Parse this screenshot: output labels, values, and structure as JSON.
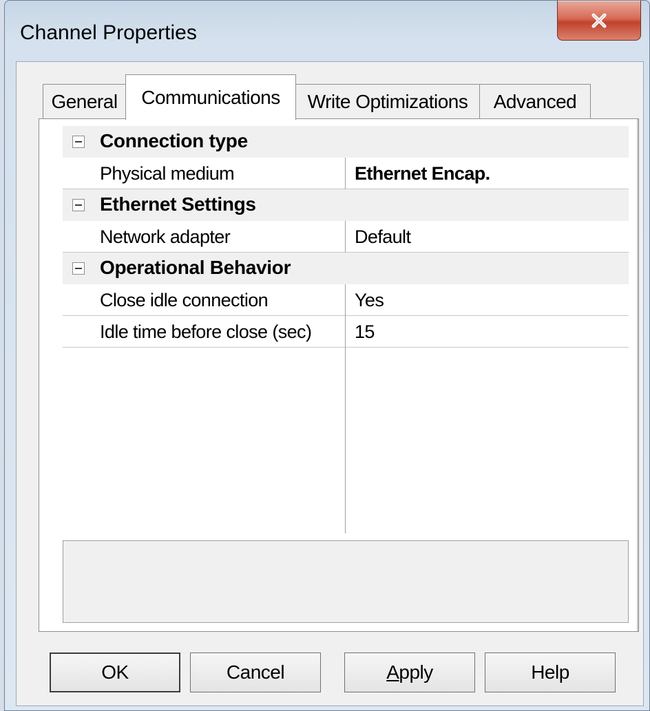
{
  "window": {
    "title": "Channel Properties",
    "close_glyph": "X"
  },
  "tabs": [
    {
      "label": "General",
      "active": false
    },
    {
      "label": "Communications",
      "active": true
    },
    {
      "label": "Write Optimizations",
      "active": false
    },
    {
      "label": "Advanced",
      "active": false
    }
  ],
  "property_grid": {
    "categories": [
      {
        "label": "Connection type",
        "expander": "minus-icon",
        "properties": [
          {
            "name": "Physical medium",
            "value": "Ethernet Encap.",
            "bold": true
          }
        ]
      },
      {
        "label": "Ethernet Settings",
        "expander": "minus-icon",
        "properties": [
          {
            "name": "Network adapter",
            "value": "Default",
            "bold": false
          }
        ]
      },
      {
        "label": "Operational Behavior",
        "expander": "minus-icon",
        "properties": [
          {
            "name": "Close idle connection",
            "value": "Yes",
            "bold": false
          },
          {
            "name": "Idle time before close (sec)",
            "value": "15",
            "bold": false
          }
        ]
      }
    ],
    "description": ""
  },
  "buttons": {
    "ok": "OK",
    "cancel": "Cancel",
    "apply_mnemonic": "A",
    "apply_rest": "pply",
    "help": "Help"
  },
  "colors": {
    "close_button": "#c0432c",
    "tab_page": "#ffffff",
    "dialog_face": "#f0f0f0"
  }
}
